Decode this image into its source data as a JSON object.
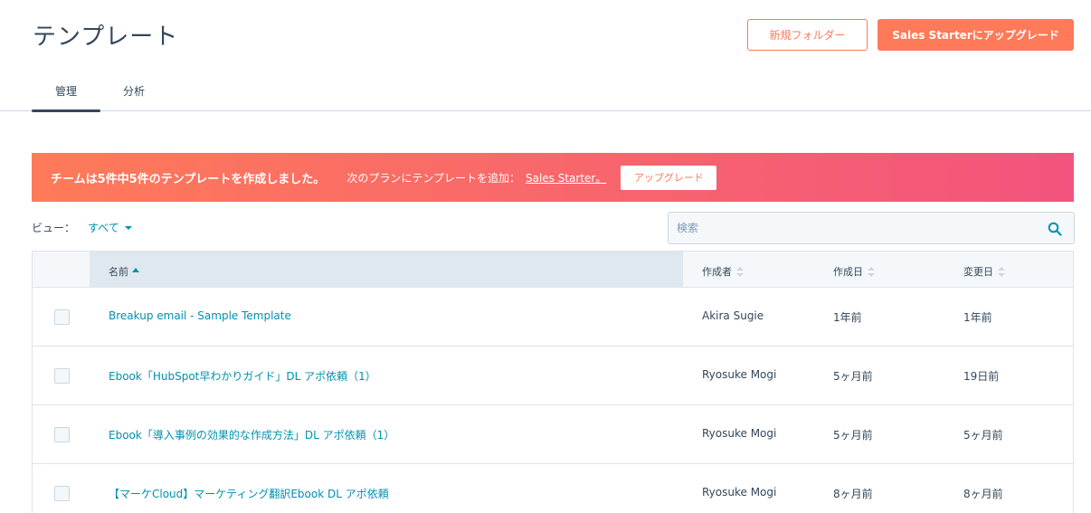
{
  "header": {
    "title": "テンプレート",
    "new_folder_label": "新規フォルダー",
    "upgrade_label": "Sales Starterにアップグレード"
  },
  "tabs": [
    {
      "label": "管理",
      "active": true
    },
    {
      "label": "分析",
      "active": false
    }
  ],
  "banner": {
    "strong_text": "チームは5件中5件のテンプレートを作成しました。",
    "text": "次のプランにテンプレートを追加：",
    "link_text": "Sales Starter。",
    "button_label": "アップグレード"
  },
  "view": {
    "label": "ビュー：",
    "selected": "すべて"
  },
  "search": {
    "placeholder": "検索"
  },
  "table": {
    "columns": {
      "name": "名前",
      "author": "作成者",
      "created": "作成日",
      "modified": "変更日"
    },
    "rows": [
      {
        "name": "Breakup email - Sample Template",
        "author": "Akira Sugie",
        "created": "1年前",
        "modified": "1年前"
      },
      {
        "name": "Ebook「HubSpot早わかりガイド」DL アポ依頼（1）",
        "author": "Ryosuke Mogi",
        "created": "5ヶ月前",
        "modified": "19日前"
      },
      {
        "name": "Ebook「導入事例の効果的な作成方法」DL アポ依頼（1）",
        "author": "Ryosuke Mogi",
        "created": "5ヶ月前",
        "modified": "5ヶ月前"
      },
      {
        "name": "【マーケCloud】マーケティング翻訳Ebook DL アポ依頼",
        "author": "Ryosuke Mogi",
        "created": "8ヶ月前",
        "modified": "8ヶ月前"
      }
    ]
  },
  "colors": {
    "accent": "#ff7a59",
    "link": "#0091ae",
    "text": "#33475b"
  }
}
